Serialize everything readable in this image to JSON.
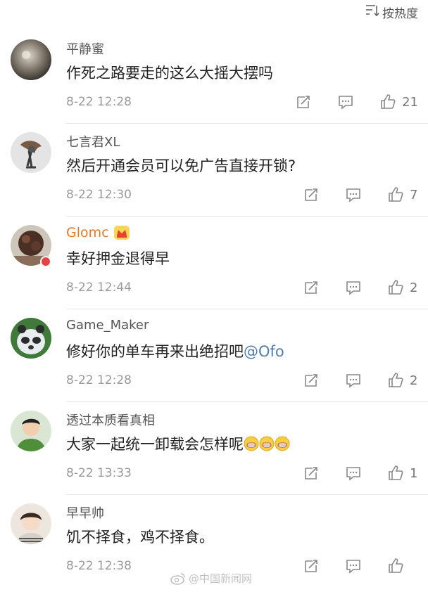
{
  "sort": {
    "label": "按热度"
  },
  "comments": [
    {
      "username": "平静蜜",
      "text": "作死之路要走的这么大摇大摆吗",
      "time": "8-22 12:28",
      "likes": "21"
    },
    {
      "username": "七言君XL",
      "text": "然后开通会员可以免广告直接开锁?",
      "time": "8-22 12:30",
      "likes": "7"
    },
    {
      "username": "Glomc",
      "text": "幸好押金退得早",
      "time": "8-22 12:44",
      "likes": "2",
      "vip": true
    },
    {
      "username": "Game_Maker",
      "text": "修好你的单车再来出绝招吧",
      "mention": "@Ofo",
      "time": "8-22 12:28",
      "likes": "2"
    },
    {
      "username": "透过本质看真相",
      "text": "大家一起统一卸载会怎样呢",
      "time": "8-22 13:33",
      "likes": "1",
      "emoji_count": 3
    },
    {
      "username": "早早帅",
      "text": "饥不择食，鸡不择食。",
      "time": "8-22 12:38",
      "likes": ""
    }
  ],
  "watermark": {
    "text": "@中国新闻网"
  },
  "colors": {
    "vip_name": "#e5792a",
    "mention": "#507daf",
    "time": "#9a9a9a",
    "divider": "#e6e6e6"
  }
}
